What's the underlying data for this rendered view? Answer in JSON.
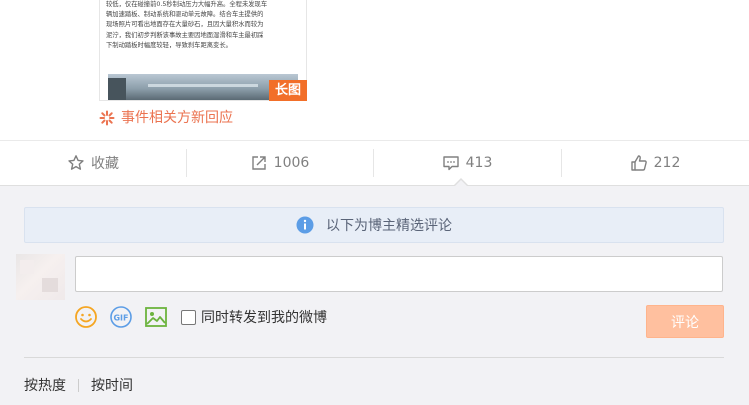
{
  "post": {
    "thumbnail_text": "较低，仅在碰撞前0.5秒制动压力大幅升高。全程未发现车\n辆加速踏板、制动系统和驱动单元故障。结合车主提供的\n现场照片可看出地面存在大量砂石，且因大量积水而较为\n泥泞，我们初步判断该事故主要因地面湿滑和车主最初踩\n下制动踏板时幅度较轻，导致刹车距离变长。",
    "long_image_badge": "长图",
    "event_link": "事件相关方新回应",
    "event_color": "#eb7350"
  },
  "actions": {
    "favorite": {
      "label": "收藏",
      "icon": "star-icon"
    },
    "repost": {
      "count": "1006",
      "icon": "share-icon"
    },
    "comment": {
      "count": "413",
      "icon": "comment-icon"
    },
    "like": {
      "count": "212",
      "icon": "thumbs-up-icon"
    }
  },
  "comments": {
    "notice": "以下为博主精选评论",
    "input_placeholder": "",
    "emoji_icon": "smiley-icon",
    "gif_icon": "gif-icon",
    "image_icon": "picture-icon",
    "repost_checkbox_label": "同时转发到我的微博",
    "submit_label": "评论",
    "submit_color": "#ffc09f",
    "sort_options": [
      "按热度",
      "按时间"
    ]
  }
}
